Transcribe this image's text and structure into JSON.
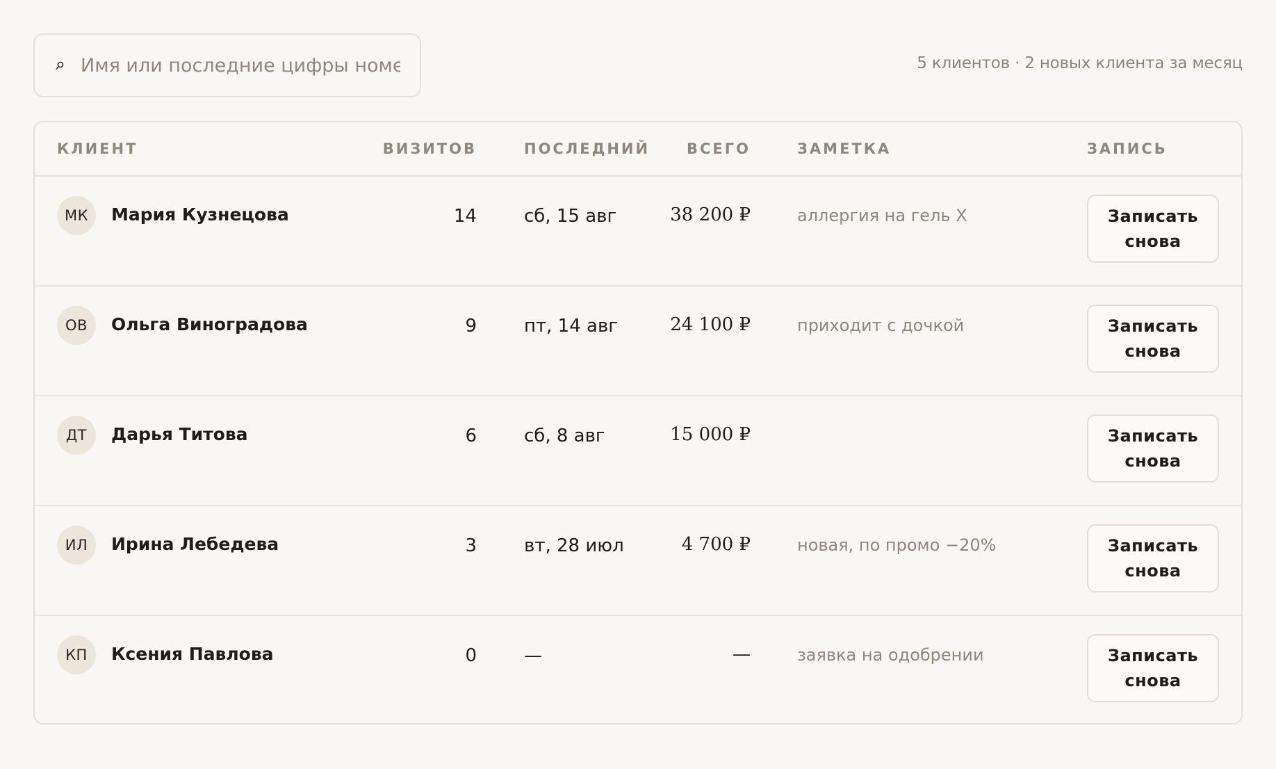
{
  "search": {
    "placeholder": "Имя или последние цифры номера"
  },
  "summary": "5 клиентов · 2 новых клиента за месяц",
  "table": {
    "columns": {
      "client": "КЛИЕНТ",
      "visits": "ВИЗИТОВ",
      "last": "ПОСЛЕДНИЙ",
      "total": "ВСЕГО",
      "note": "ЗАМЕТКА",
      "booking": "ЗАПИСЬ"
    },
    "rows": [
      {
        "initials": "МК",
        "name": "Мария Кузнецова",
        "visits": "14",
        "last": "сб, 15 авг",
        "total": "38 200 ₽",
        "note": "аллергия на гель X",
        "action": "Записать снова"
      },
      {
        "initials": "ОВ",
        "name": "Ольга Виноградова",
        "visits": "9",
        "last": "пт, 14 авг",
        "total": "24 100 ₽",
        "note": "приходит с дочкой",
        "action": "Записать снова"
      },
      {
        "initials": "ДТ",
        "name": "Дарья Титова",
        "visits": "6",
        "last": "сб, 8 авг",
        "total": "15 000 ₽",
        "note": "",
        "action": "Записать снова"
      },
      {
        "initials": "ИЛ",
        "name": "Ирина Лебедева",
        "visits": "3",
        "last": "вт, 28 июл",
        "total": "4 700 ₽",
        "note": "новая, по промо −20%",
        "action": "Записать снова"
      },
      {
        "initials": "КП",
        "name": "Ксения Павлова",
        "visits": "0",
        "last": "—",
        "total": "—",
        "note": "заявка на одобрении",
        "action": "Записать снова"
      }
    ]
  },
  "colors": {
    "background": "#f9f7f3",
    "border": "#e6e1d8",
    "muted_text": "#8d877d",
    "avatar_bg": "#ebe5da"
  }
}
